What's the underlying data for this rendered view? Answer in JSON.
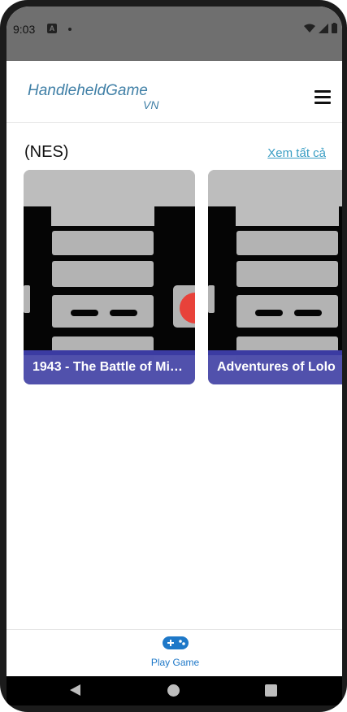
{
  "status_bar": {
    "time": "9:03",
    "notification_icon": "A"
  },
  "header": {
    "logo_main": "HandleheldGame",
    "logo_sub": "VN",
    "menu_icon": "hamburger-icon"
  },
  "section": {
    "title": "(NES)",
    "see_all": "Xem tất cả"
  },
  "cards": [
    {
      "title": "1943 - The Battle of Mid..."
    },
    {
      "title": "Adventures of Lolo"
    }
  ],
  "bottom_nav": {
    "label": "Play Game",
    "icon": "gamepad-icon"
  },
  "colors": {
    "accent": "#1e78c8",
    "link": "#3a9ec4",
    "card_overlay": "#4242aa",
    "logo": "#3f7fa6"
  }
}
